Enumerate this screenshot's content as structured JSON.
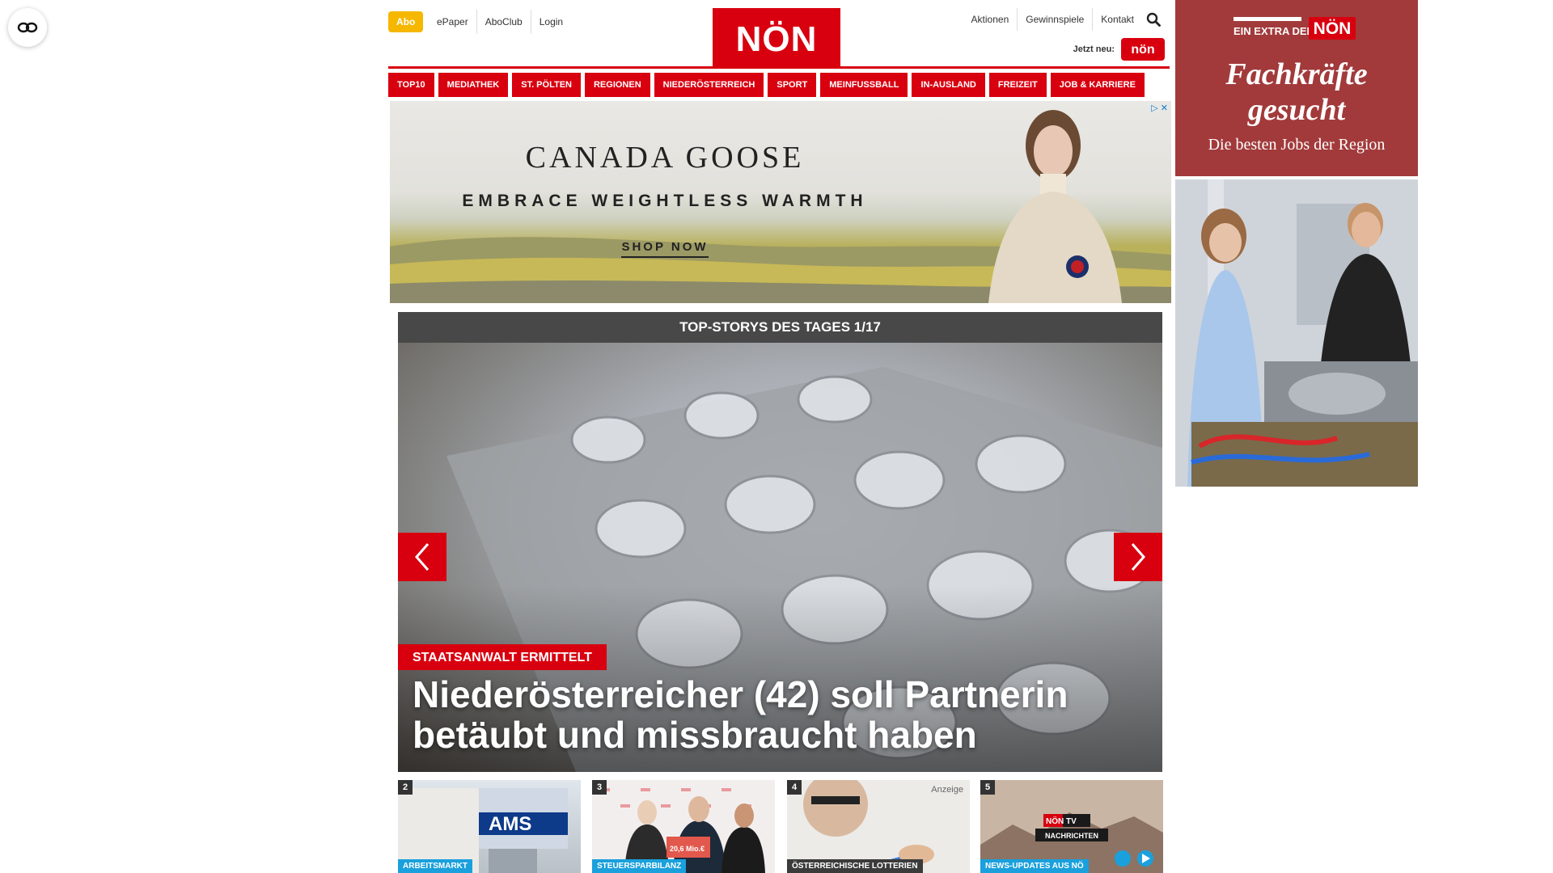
{
  "header": {
    "abo_label": "Abo",
    "top_links": [
      "ePaper",
      "AboClub",
      "Login"
    ],
    "logo_text": "NÖN",
    "right_links": [
      "Aktionen",
      "Gewinnspiele",
      "Kontakt"
    ],
    "jetzt_label": "Jetzt neu:",
    "jetzt_badge": "nön"
  },
  "nav": {
    "items": [
      "TOP10",
      "MEDIATHEK",
      "ST. PÖLTEN",
      "REGIONEN",
      "NIEDERÖSTERREICH",
      "SPORT",
      "MEINFUSSBALL",
      "IN-AUSLAND",
      "FREIZEIT",
      "JOB & KARRIERE"
    ]
  },
  "ad_top": {
    "adchoices": "▷ ✕",
    "brand": "CANADA GOOSE",
    "slogan": "EMBRACE WEIGHTLESS WARMTH",
    "cta": "SHOP NOW"
  },
  "side_ad": {
    "extra_label": "EIN EXTRA DER",
    "logo": "NÖN",
    "title_line1": "Fachkräfte",
    "title_line2": "gesucht",
    "subtitle": "Die besten Jobs der Region"
  },
  "stories": {
    "header": "TOP-STORYS DES TAGES 1/17",
    "hero_tag": "STAATSANWALT ERMITTELT",
    "hero_title": "Niederösterreicher (42) soll Partnerin betäubt und missbraucht haben"
  },
  "thumbs": [
    {
      "num": "2",
      "tag": "ARBEITSMARKT",
      "logo": "AMS"
    },
    {
      "num": "3",
      "tag": "STEUERSPARBILANZ",
      "sign": "20,6 Mio.€"
    },
    {
      "num": "4",
      "tag": "ÖSTERREICHISCHE LOTTERIEN",
      "anzeige": "Anzeige"
    },
    {
      "num": "5",
      "tag": "NEWS-UPDATES AUS NÖ",
      "tv_label": "NÖN TV",
      "tv_sub": "NACHRICHTEN"
    }
  ],
  "colors": {
    "brand_red": "#d8000f",
    "abo_yellow": "#f5b700",
    "stories_bar": "#484848",
    "side_ad_bg": "#a23a3b"
  },
  "icons": {
    "accessibility": "accessibility-icon",
    "search": "search-icon",
    "prev": "chevron-left-icon",
    "next": "chevron-right-icon"
  }
}
